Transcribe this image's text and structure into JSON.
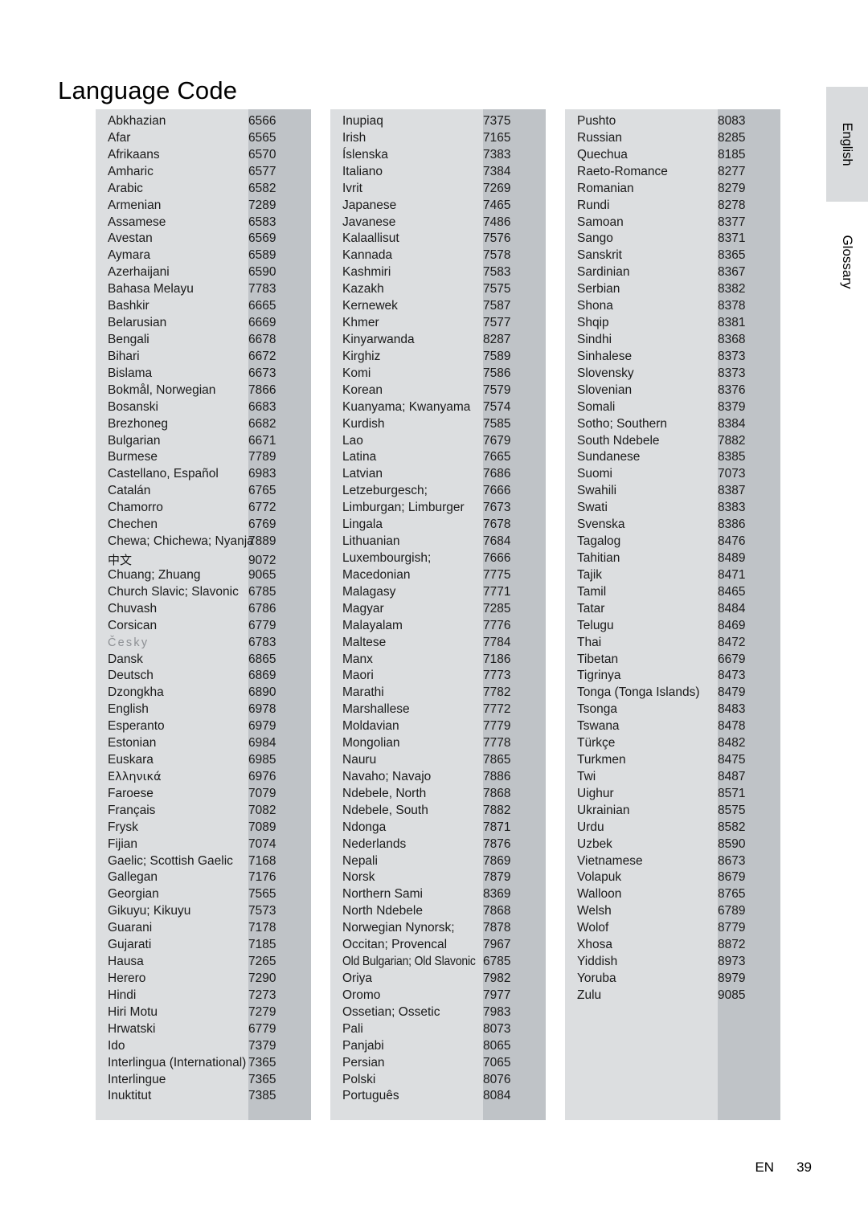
{
  "page": {
    "title": "Language Code",
    "footer_locale": "EN",
    "footer_page_number": "39"
  },
  "side_tabs": {
    "english_label": "English",
    "glossary_label": "Glossary"
  },
  "colors": {
    "block_background": "#dcdee0",
    "code_band": "#bfc3c7",
    "tab_background": "#d9dbdd",
    "text": "#1a1a1a",
    "faded_text": "#8d9094"
  },
  "columns": [
    {
      "rows": [
        {
          "name": "Abkhazian",
          "code": "6566"
        },
        {
          "name": "Afar",
          "code": "6565"
        },
        {
          "name": "Afrikaans",
          "code": "6570"
        },
        {
          "name": "Amharic",
          "code": "6577"
        },
        {
          "name": "Arabic",
          "code": "6582"
        },
        {
          "name": "Armenian",
          "code": "7289"
        },
        {
          "name": "Assamese",
          "code": "6583"
        },
        {
          "name": "Avestan",
          "code": "6569"
        },
        {
          "name": "Aymara",
          "code": "6589"
        },
        {
          "name": "Azerhaijani",
          "code": "6590"
        },
        {
          "name": "Bahasa Melayu",
          "code": "7783"
        },
        {
          "name": "Bashkir",
          "code": "6665"
        },
        {
          "name": "Belarusian",
          "code": "6669"
        },
        {
          "name": "Bengali",
          "code": "6678"
        },
        {
          "name": "Bihari",
          "code": "6672"
        },
        {
          "name": "Bislama",
          "code": "6673"
        },
        {
          "name": "Bokmål, Norwegian",
          "code": "7866"
        },
        {
          "name": "Bosanski",
          "code": "6683"
        },
        {
          "name": "Brezhoneg",
          "code": "6682"
        },
        {
          "name": "Bulgarian",
          "code": "6671"
        },
        {
          "name": "Burmese",
          "code": "7789"
        },
        {
          "name": "Castellano, Español",
          "code": "6983"
        },
        {
          "name": "Catalán",
          "code": "6765"
        },
        {
          "name": "Chamorro",
          "code": "6772"
        },
        {
          "name": "Chechen",
          "code": "6769"
        },
        {
          "name": "Chewa; Chichewa; Nyanja",
          "code": "7889",
          "style": "wide"
        },
        {
          "name": "中文",
          "code": "9072",
          "style": "cjk"
        },
        {
          "name": "Chuang; Zhuang",
          "code": "9065"
        },
        {
          "name": "Church Slavic; Slavonic",
          "code": "6785"
        },
        {
          "name": "Chuvash",
          "code": "6786"
        },
        {
          "name": "Corsican",
          "code": "6779"
        },
        {
          "name": "Česky",
          "code": "6783",
          "style": "faded"
        },
        {
          "name": "Dansk",
          "code": "6865"
        },
        {
          "name": "Deutsch",
          "code": "6869"
        },
        {
          "name": "Dzongkha",
          "code": "6890"
        },
        {
          "name": "English",
          "code": "6978"
        },
        {
          "name": "Esperanto",
          "code": "6979"
        },
        {
          "name": "Estonian",
          "code": "6984"
        },
        {
          "name": "Euskara",
          "code": "6985"
        },
        {
          "name": "Ελληνικά",
          "code": "6976",
          "style": "greek"
        },
        {
          "name": "Faroese",
          "code": "7079"
        },
        {
          "name": "Français",
          "code": "7082"
        },
        {
          "name": "Frysk",
          "code": "7089"
        },
        {
          "name": "Fijian",
          "code": "7074"
        },
        {
          "name": "Gaelic; Scottish Gaelic",
          "code": "7168"
        },
        {
          "name": "Gallegan",
          "code": "7176"
        },
        {
          "name": "Georgian",
          "code": "7565"
        },
        {
          "name": "Gikuyu; Kikuyu",
          "code": "7573"
        },
        {
          "name": "Guarani",
          "code": "7178"
        },
        {
          "name": "Gujarati",
          "code": "7185"
        },
        {
          "name": "Hausa",
          "code": "7265"
        },
        {
          "name": "Herero",
          "code": "7290"
        },
        {
          "name": "Hindi",
          "code": "7273"
        },
        {
          "name": "Hiri Motu",
          "code": "7279"
        },
        {
          "name": "Hrwatski",
          "code": "6779"
        },
        {
          "name": "Ido",
          "code": "7379"
        },
        {
          "name": "Interlingua (International)",
          "code": "7365",
          "style": "wide"
        },
        {
          "name": "Interlingue",
          "code": "7365"
        },
        {
          "name": "Inuktitut",
          "code": "7385"
        }
      ]
    },
    {
      "rows": [
        {
          "name": "Inupiaq",
          "code": "7375"
        },
        {
          "name": "Irish",
          "code": "7165"
        },
        {
          "name": "Íslenska",
          "code": "7383"
        },
        {
          "name": "Italiano",
          "code": "7384"
        },
        {
          "name": "Ivrit",
          "code": "7269"
        },
        {
          "name": "Japanese",
          "code": "7465"
        },
        {
          "name": "Javanese",
          "code": "7486"
        },
        {
          "name": "Kalaallisut",
          "code": "7576"
        },
        {
          "name": "Kannada",
          "code": "7578"
        },
        {
          "name": "Kashmiri",
          "code": "7583"
        },
        {
          "name": "Kazakh",
          "code": "7575"
        },
        {
          "name": "Kernewek",
          "code": "7587"
        },
        {
          "name": "Khmer",
          "code": "7577"
        },
        {
          "name": "Kinyarwanda",
          "code": "8287"
        },
        {
          "name": "Kirghiz",
          "code": "7589"
        },
        {
          "name": "Komi",
          "code": "7586"
        },
        {
          "name": "Korean",
          "code": "7579"
        },
        {
          "name": "Kuanyama; Kwanyama",
          "code": "7574"
        },
        {
          "name": "Kurdish",
          "code": "7585"
        },
        {
          "name": "Lao",
          "code": "7679"
        },
        {
          "name": "Latina",
          "code": "7665"
        },
        {
          "name": "Latvian",
          "code": "7686"
        },
        {
          "name": "Letzeburgesch;",
          "code": "7666"
        },
        {
          "name": "Limburgan; Limburger",
          "code": "7673"
        },
        {
          "name": "Lingala",
          "code": "7678"
        },
        {
          "name": "Lithuanian",
          "code": "7684"
        },
        {
          "name": "Luxembourgish;",
          "code": "7666"
        },
        {
          "name": "Macedonian",
          "code": "7775"
        },
        {
          "name": "Malagasy",
          "code": "7771"
        },
        {
          "name": "Magyar",
          "code": "7285"
        },
        {
          "name": "Malayalam",
          "code": "7776"
        },
        {
          "name": "Maltese",
          "code": "7784"
        },
        {
          "name": "Manx",
          "code": "7186"
        },
        {
          "name": "Maori",
          "code": "7773"
        },
        {
          "name": "Marathi",
          "code": "7782"
        },
        {
          "name": "Marshallese",
          "code": "7772"
        },
        {
          "name": "Moldavian",
          "code": "7779"
        },
        {
          "name": "Mongolian",
          "code": "7778"
        },
        {
          "name": "Nauru",
          "code": "7865"
        },
        {
          "name": "Navaho; Navajo",
          "code": "7886"
        },
        {
          "name": "Ndebele, North",
          "code": "7868"
        },
        {
          "name": "Ndebele, South",
          "code": "7882"
        },
        {
          "name": "Ndonga",
          "code": "7871"
        },
        {
          "name": "Nederlands",
          "code": "7876"
        },
        {
          "name": "Nepali",
          "code": "7869"
        },
        {
          "name": "Norsk",
          "code": "7879"
        },
        {
          "name": "Northern Sami",
          "code": "8369"
        },
        {
          "name": "North Ndebele",
          "code": "7868"
        },
        {
          "name": "Norwegian Nynorsk;",
          "code": "7878"
        },
        {
          "name": "Occitan; Provencal",
          "code": "7967"
        },
        {
          "name": "Old Bulgarian; Old Slavonic",
          "code": "6785",
          "style": "condensed"
        },
        {
          "name": "Oriya",
          "code": "7982"
        },
        {
          "name": "Oromo",
          "code": "7977"
        },
        {
          "name": "Ossetian; Ossetic",
          "code": "7983"
        },
        {
          "name": "Pali",
          "code": "8073"
        },
        {
          "name": "Panjabi",
          "code": "8065"
        },
        {
          "name": "Persian",
          "code": "7065"
        },
        {
          "name": "Polski",
          "code": "8076"
        },
        {
          "name": "Português",
          "code": "8084"
        }
      ]
    },
    {
      "rows": [
        {
          "name": "Pushto",
          "code": "8083"
        },
        {
          "name": "Russian",
          "code": "8285"
        },
        {
          "name": "Quechua",
          "code": "8185"
        },
        {
          "name": "Raeto-Romance",
          "code": "8277"
        },
        {
          "name": "Romanian",
          "code": "8279"
        },
        {
          "name": "Rundi",
          "code": "8278"
        },
        {
          "name": "Samoan",
          "code": "8377"
        },
        {
          "name": "Sango",
          "code": "8371"
        },
        {
          "name": "Sanskrit",
          "code": "8365"
        },
        {
          "name": "Sardinian",
          "code": "8367"
        },
        {
          "name": "Serbian",
          "code": "8382"
        },
        {
          "name": "Shona",
          "code": "8378"
        },
        {
          "name": "Shqip",
          "code": "8381"
        },
        {
          "name": "Sindhi",
          "code": "8368"
        },
        {
          "name": "Sinhalese",
          "code": "8373"
        },
        {
          "name": "Slovensky",
          "code": "8373"
        },
        {
          "name": "Slovenian",
          "code": "8376"
        },
        {
          "name": "Somali",
          "code": "8379"
        },
        {
          "name": "Sotho; Southern",
          "code": "8384"
        },
        {
          "name": "South Ndebele",
          "code": "7882"
        },
        {
          "name": "Sundanese",
          "code": "8385"
        },
        {
          "name": "Suomi",
          "code": "7073"
        },
        {
          "name": "Swahili",
          "code": "8387"
        },
        {
          "name": "Swati",
          "code": "8383"
        },
        {
          "name": "Svenska",
          "code": "8386"
        },
        {
          "name": "Tagalog",
          "code": "8476"
        },
        {
          "name": "Tahitian",
          "code": "8489"
        },
        {
          "name": "Tajik",
          "code": "8471"
        },
        {
          "name": "Tamil",
          "code": "8465"
        },
        {
          "name": "Tatar",
          "code": "8484"
        },
        {
          "name": "Telugu",
          "code": "8469"
        },
        {
          "name": "Thai",
          "code": "8472"
        },
        {
          "name": "Tibetan",
          "code": "6679"
        },
        {
          "name": "Tigrinya",
          "code": "8473"
        },
        {
          "name": "Tonga (Tonga Islands)",
          "code": "8479"
        },
        {
          "name": "Tsonga",
          "code": "8483"
        },
        {
          "name": "Tswana",
          "code": "8478"
        },
        {
          "name": "Türkçe",
          "code": "8482"
        },
        {
          "name": "Turkmen",
          "code": "8475"
        },
        {
          "name": "Twi",
          "code": "8487"
        },
        {
          "name": "Uighur",
          "code": "8571"
        },
        {
          "name": "Ukrainian",
          "code": "8575"
        },
        {
          "name": "Urdu",
          "code": "8582"
        },
        {
          "name": "Uzbek",
          "code": "8590"
        },
        {
          "name": "Vietnamese",
          "code": "8673"
        },
        {
          "name": "Volapuk",
          "code": "8679"
        },
        {
          "name": "Walloon",
          "code": "8765"
        },
        {
          "name": "Welsh",
          "code": "6789"
        },
        {
          "name": "Wolof",
          "code": "8779"
        },
        {
          "name": "Xhosa",
          "code": "8872"
        },
        {
          "name": "Yiddish",
          "code": "8973"
        },
        {
          "name": "Yoruba",
          "code": "8979"
        },
        {
          "name": "Zulu",
          "code": "9085"
        }
      ]
    }
  ]
}
